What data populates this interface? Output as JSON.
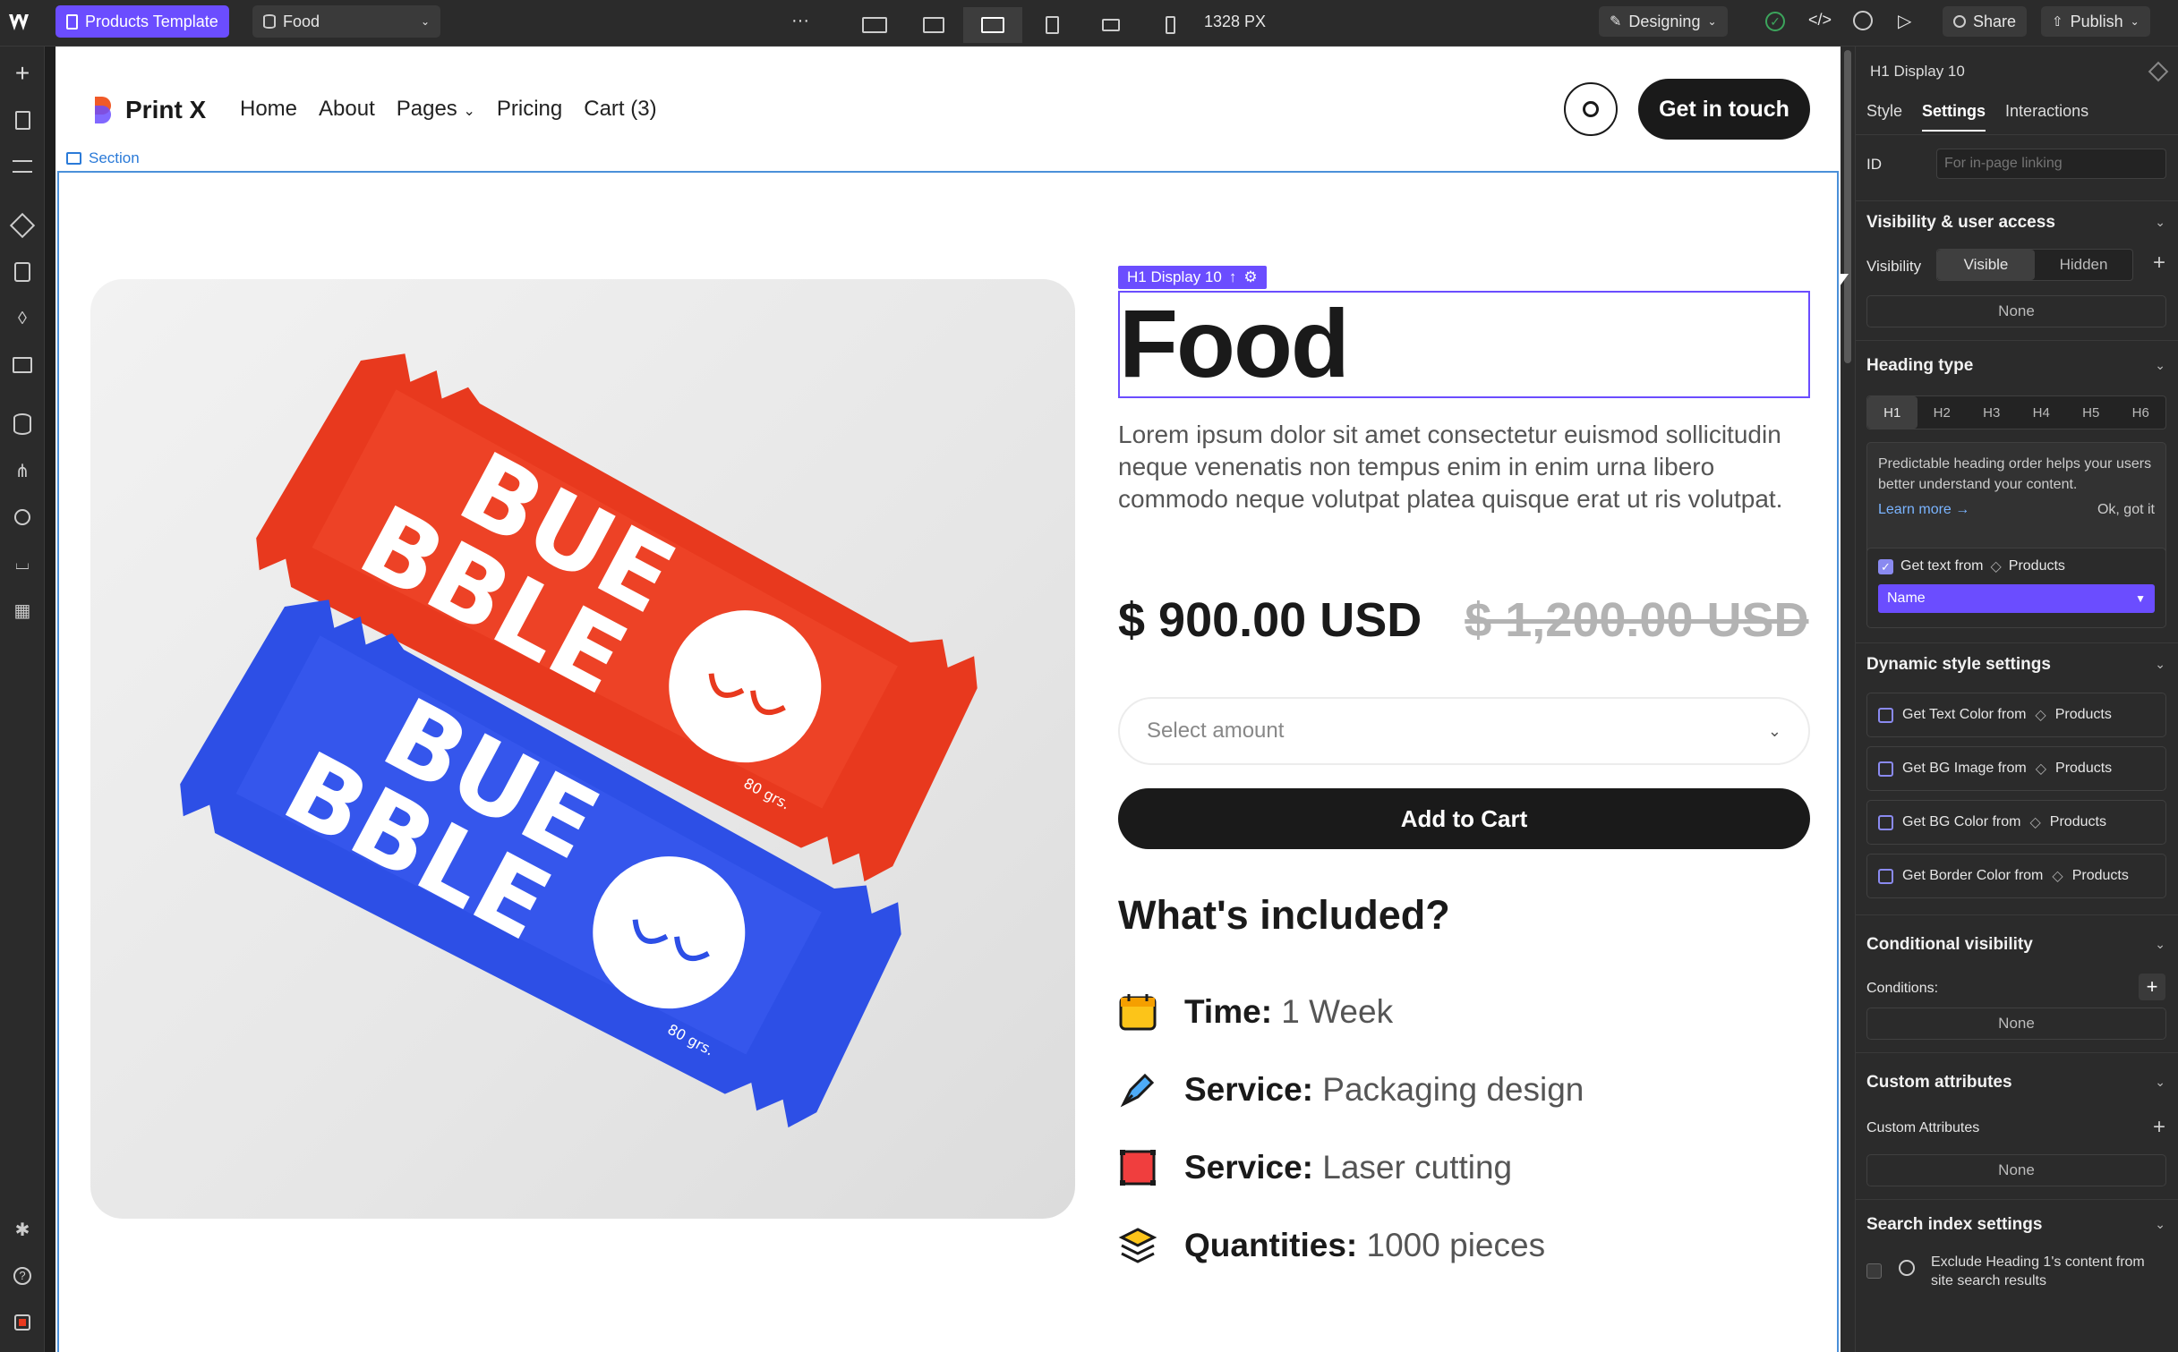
{
  "topbar": {
    "page_label": "Products Template",
    "collection_label": "Food",
    "more": "···",
    "width_readout": "1328 PX",
    "mode_label": "Designing",
    "share_label": "Share",
    "publish_label": "Publish"
  },
  "site": {
    "logo_text": "Print X",
    "nav": [
      "Home",
      "About",
      "Pages",
      "Pricing",
      "Cart (3)"
    ],
    "cta": "Get in touch",
    "section_tag": "Section"
  },
  "product": {
    "selection_badge": "H1 Display 10",
    "title": "Food",
    "description": "Lorem ipsum dolor sit amet consectetur euismod sollicitudin neque venenatis non tempus enim in enim urna libero commodo neque volutpat platea quisque erat ut ris volutpat.",
    "price": "$ 900.00 USD",
    "compare_price": "$ 1,200.00 USD",
    "select_placeholder": "Select amount",
    "add_to_cart": "Add to Cart",
    "included_heading": "What's included?",
    "included": [
      {
        "label": "Time:",
        "value": "1 Week",
        "icon": "calendar-icon"
      },
      {
        "label": "Service:",
        "value": "Packaging design",
        "icon": "pen-tool-icon"
      },
      {
        "label": "Service:",
        "value": "Laser cutting",
        "icon": "laser-frame-icon"
      },
      {
        "label": "Quantities:",
        "value": "1000 pieces",
        "icon": "layers-icon"
      }
    ],
    "bar_text_1": "BUE",
    "bar_text_2": "BBLE",
    "bar_weight": "80 grs."
  },
  "panel": {
    "element_label": "H1 Display 10",
    "tabs": [
      "Style",
      "Settings",
      "Interactions"
    ],
    "active_tab": "Settings",
    "id_label": "ID",
    "id_placeholder": "For in-page linking",
    "visibility_heading": "Visibility & user access",
    "visibility_label": "Visibility",
    "visible": "Visible",
    "hidden": "Hidden",
    "visibility_none": "None",
    "heading_type_heading": "Heading type",
    "heading_levels": [
      "H1",
      "H2",
      "H3",
      "H4",
      "H5",
      "H6"
    ],
    "active_heading": "H1",
    "hint": "Predictable heading order helps your users better understand your content.",
    "learn_more": "Learn more →",
    "ok_got_it": "Ok, got it",
    "get_text_from": "Get text from",
    "products": "Products",
    "field_name": "Name",
    "dynamic_heading": "Dynamic style settings",
    "dynamic": [
      "Get Text Color from",
      "Get BG Image from",
      "Get BG Color from",
      "Get Border Color from"
    ],
    "conditional_heading": "Conditional visibility",
    "conditions_label": "Conditions:",
    "conditions_none": "None",
    "custom_attr_heading": "Custom attributes",
    "custom_attr_label": "Custom Attributes",
    "custom_attr_none": "None",
    "search_heading": "Search index settings",
    "exclude_text": "Exclude Heading 1's content from site search results"
  },
  "colors": {
    "accent_purple": "#6b4dff",
    "webflow_blue": "#4a90d9",
    "bar_red": "#e8391e",
    "bar_blue": "#2d4fe6",
    "dark": "#1a1a1a"
  }
}
